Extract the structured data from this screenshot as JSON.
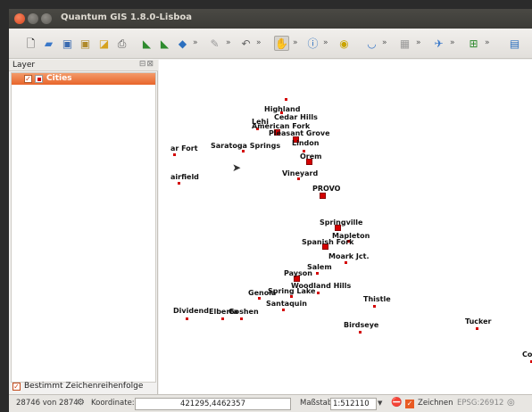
{
  "window": {
    "title": "Quantum GIS 1.8.0-Lisboa"
  },
  "toolbar": {
    "icons": [
      "new-project-icon",
      "open-project-icon",
      "save-project-icon",
      "save-as-icon",
      "new-print-composer-icon",
      "print-icon",
      "add-layer-icon",
      "remove-layer-icon",
      "layer-properties-icon",
      "overflow-icon",
      "digitize-pencil-icon",
      "overflow-icon",
      "undo-icon",
      "overflow-icon",
      "pan-icon",
      "overflow-icon",
      "identify-icon",
      "overflow-icon",
      "plugin-icon",
      "overflow-icon",
      "measure-icon",
      "overflow-icon",
      "attribute-table-icon",
      "overflow-icon",
      "label-icon",
      "overflow-icon",
      "plugins-manager-icon",
      "overflow-icon",
      "python-console-icon"
    ],
    "more": "»"
  },
  "layers_panel": {
    "title": "Layer",
    "header_icons": "⊟⊠",
    "layers": [
      {
        "name": "Cities",
        "checked": true,
        "check_glyph": "✓"
      }
    ],
    "render_order": {
      "label": "Bestimmt Zeichenreihenfolge",
      "checked": true,
      "check_glyph": "✓"
    }
  },
  "map": {
    "cities": [
      {
        "name": "Highland"
      },
      {
        "name": "Cedar Hills"
      },
      {
        "name": "Lehi"
      },
      {
        "name": "American Fork"
      },
      {
        "name": "Pleasant Grove"
      },
      {
        "name": "Lindon"
      },
      {
        "name": "Saratoga Springs"
      },
      {
        "name": "Orem"
      },
      {
        "name": "ar Fort"
      },
      {
        "name": "Vineyard"
      },
      {
        "name": "airfield"
      },
      {
        "name": "PROVO"
      },
      {
        "name": "Springville"
      },
      {
        "name": "Mapleton"
      },
      {
        "name": "Spanish Fork"
      },
      {
        "name": "Moark Jct."
      },
      {
        "name": "Salem"
      },
      {
        "name": "Payson"
      },
      {
        "name": "Woodland Hills"
      },
      {
        "name": "Genola"
      },
      {
        "name": "Spring Lake"
      },
      {
        "name": "Thistle"
      },
      {
        "name": "Santaquin"
      },
      {
        "name": "Dividend"
      },
      {
        "name": "Elberta"
      },
      {
        "name": "Goshen"
      },
      {
        "name": "Birdseye"
      },
      {
        "name": "Tucker"
      },
      {
        "name": "Col"
      }
    ]
  },
  "status": {
    "features": "28746 von 2874",
    "coord_label": "Koordinate:",
    "coord_value": "421295,4462357",
    "scale_label": "Maßstab",
    "scale_value": "1:512110",
    "render_label": "Zeichnen",
    "crs": "EPSG:26912"
  }
}
